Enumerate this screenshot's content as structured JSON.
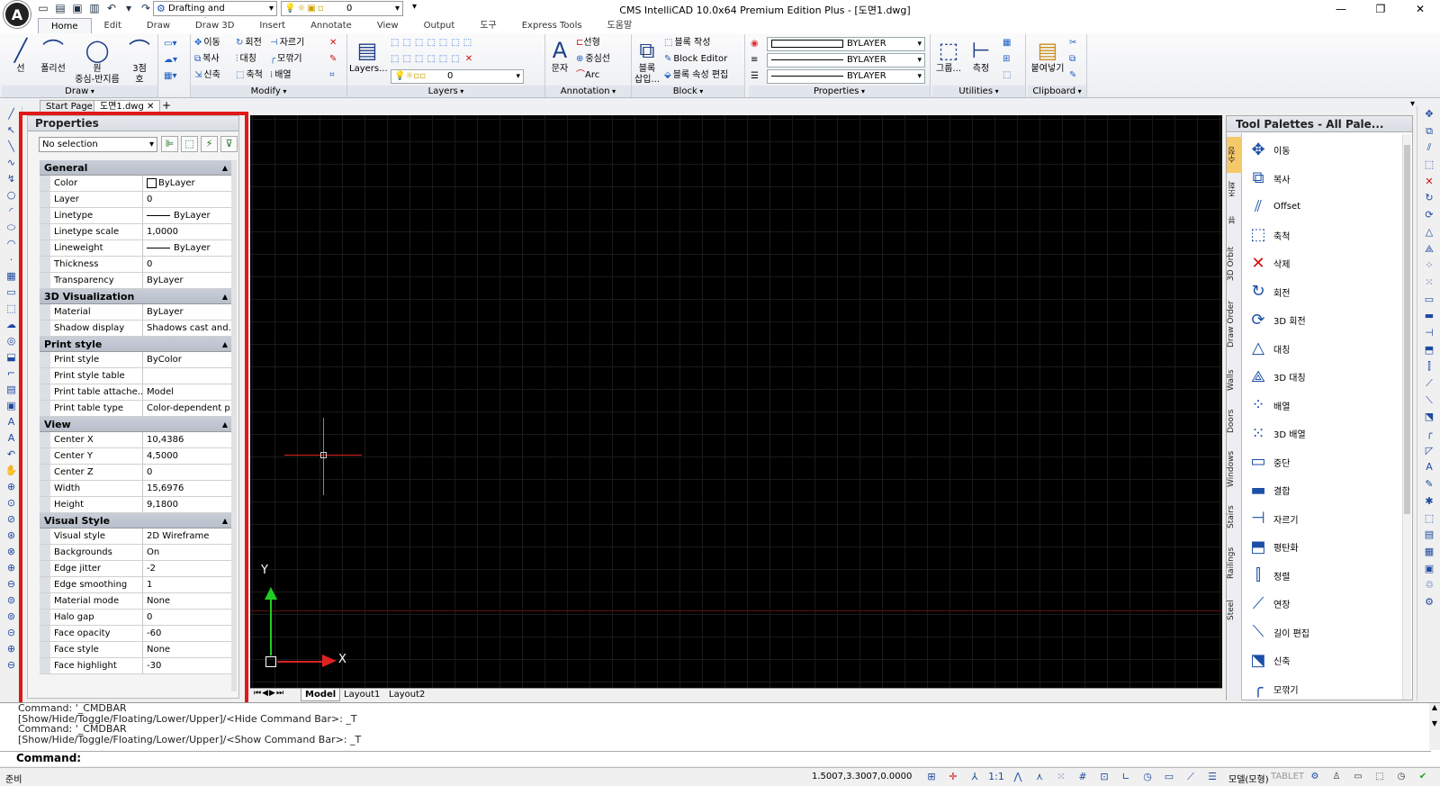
{
  "titlebar": {
    "app_logo": "A",
    "title": "CMS IntelliCAD 10.0x64 Premium Edition Plus  - [도면1.dwg]",
    "workspace": "Drafting and Annotation",
    "current_layer": "0",
    "minimize": "—",
    "maximize": "❐",
    "close": "✕"
  },
  "ribbon_tabs": [
    "Home",
    "Edit",
    "Draw",
    "Draw 3D",
    "Insert",
    "Annotate",
    "View",
    "Output",
    "도구",
    "Express Tools",
    "도움말"
  ],
  "ribbon": {
    "draw": {
      "title": "Draw",
      "line": "선",
      "polyline": "폴리선",
      "circle": "원",
      "circle_sub": "중심-반지름",
      "arc": "3점",
      "arc_sub": "호"
    },
    "modify": {
      "title": "Modify",
      "move": "이동",
      "rotate": "회전",
      "trim": "자르기",
      "copy": "복사",
      "mirror": "대칭",
      "fillet": "모깎기",
      "stretch": "신축",
      "scale": "축척",
      "array": "배열"
    },
    "layers": {
      "title": "Layers",
      "layers_btn": "Layers...",
      "layer_value": "0"
    },
    "annotation": {
      "title": "Annotation",
      "text": "문자",
      "linear": "선형",
      "multileader": "중심선",
      "arc": "Arc"
    },
    "block": {
      "title": "Block",
      "insert": "블록",
      "insert_sub": "삽입...",
      "create": "블록 작성",
      "editor": "Block Editor",
      "attr_edit": "블록 속성 편집"
    },
    "properties": {
      "title": "Properties",
      "color": "BYLAYER",
      "linetype": "BYLAYER",
      "lineweight": "BYLAYER"
    },
    "utilities": {
      "title": "Utilities",
      "group": "그룹...",
      "measure": "측정"
    },
    "clipboard": {
      "title": "Clipboard",
      "paste": "붙여넣기"
    }
  },
  "doc_tabs": [
    "Start Page",
    "도면1.dwg"
  ],
  "properties_panel": {
    "title": "Properties",
    "selection": "No selection",
    "categories": [
      {
        "name": "General",
        "rows": [
          {
            "name": "Color",
            "value": "ByLayer"
          },
          {
            "name": "Layer",
            "value": "0"
          },
          {
            "name": "Linetype",
            "value": "ByLayer"
          },
          {
            "name": "Linetype scale",
            "value": "1,0000"
          },
          {
            "name": "Lineweight",
            "value": "ByLayer"
          },
          {
            "name": "Thickness",
            "value": "0"
          },
          {
            "name": "Transparency",
            "value": "ByLayer"
          }
        ]
      },
      {
        "name": "3D Visualization",
        "rows": [
          {
            "name": "Material",
            "value": "ByLayer"
          },
          {
            "name": "Shadow display",
            "value": "Shadows cast and..."
          }
        ]
      },
      {
        "name": "Print style",
        "rows": [
          {
            "name": "Print style",
            "value": "ByColor"
          },
          {
            "name": "Print style table",
            "value": ""
          },
          {
            "name": "Print table attache...",
            "value": "Model"
          },
          {
            "name": "Print table type",
            "value": "Color-dependent p..."
          }
        ]
      },
      {
        "name": "View",
        "rows": [
          {
            "name": "Center X",
            "value": "10,4386"
          },
          {
            "name": "Center Y",
            "value": "4,5000"
          },
          {
            "name": "Center Z",
            "value": "0"
          },
          {
            "name": "Width",
            "value": "15,6976"
          },
          {
            "name": "Height",
            "value": "9,1800"
          }
        ]
      },
      {
        "name": "Visual Style",
        "rows": [
          {
            "name": "Visual style",
            "value": "2D Wireframe"
          },
          {
            "name": "Backgrounds",
            "value": "On"
          },
          {
            "name": "Edge jitter",
            "value": "-2"
          },
          {
            "name": "Edge smoothing",
            "value": "1"
          },
          {
            "name": "Material mode",
            "value": "None"
          },
          {
            "name": "Halo gap",
            "value": "0"
          },
          {
            "name": "Face opacity",
            "value": "-60"
          },
          {
            "name": "Face style",
            "value": "None"
          },
          {
            "name": "Face highlight",
            "value": "-30"
          }
        ]
      }
    ]
  },
  "canvas": {
    "ucs_x": "X",
    "ucs_y": "Y",
    "layout_tabs": [
      "Model",
      "Layout1",
      "Layout2"
    ]
  },
  "tool_palettes": {
    "title": "Tool Palettes - All Pale...",
    "vertical_tabs": [
      "수정",
      "조회",
      "뷰",
      "3D Orbit",
      "Draw Order",
      "Walls",
      "Doors",
      "Windows",
      "Stairs",
      "Railings",
      "Steel"
    ],
    "items": [
      "이동",
      "복사",
      "Offset",
      "축척",
      "삭제",
      "회전",
      "3D 회전",
      "대칭",
      "3D 대칭",
      "배열",
      "3D 배열",
      "중단",
      "결합",
      "자르기",
      "평탄화",
      "정렬",
      "연장",
      "길이 편집",
      "신축",
      "모깎기"
    ]
  },
  "command": {
    "history": [
      "Command: '_CMDBAR",
      "[Show/Hide/Toggle/Floating/Lower/Upper]/<Hide Command Bar>: _T",
      "Command: '_CMDBAR",
      "[Show/Hide/Toggle/Floating/Lower/Upper]/<Show Command Bar>: _T"
    ],
    "prompt": "Command:"
  },
  "status": {
    "ready": "준비",
    "coords": "1.5007,3.3007,0.0000",
    "scale": "1:1",
    "mode": "모델(모형)",
    "tablet": "TABLET"
  },
  "colors": {
    "highlight": "#e01818",
    "canvas_bg": "#000000",
    "ucs_x": "#dd2222",
    "ucs_y": "#22cc22"
  }
}
